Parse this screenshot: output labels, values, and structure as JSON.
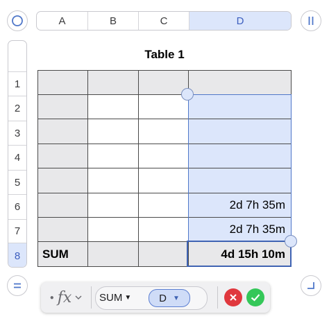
{
  "columns": [
    {
      "label": "A",
      "selected": false
    },
    {
      "label": "B",
      "selected": false
    },
    {
      "label": "C",
      "selected": false
    },
    {
      "label": "D",
      "selected": true
    }
  ],
  "rows": [
    {
      "label": "1",
      "selected": false
    },
    {
      "label": "2",
      "selected": false
    },
    {
      "label": "3",
      "selected": false
    },
    {
      "label": "4",
      "selected": false
    },
    {
      "label": "5",
      "selected": false
    },
    {
      "label": "6",
      "selected": false
    },
    {
      "label": "7",
      "selected": false
    },
    {
      "label": "8",
      "selected": true
    }
  ],
  "table": {
    "title": "Table 1",
    "cells": {
      "r6_d": "2d 7h 35m",
      "r7_d": "2d 7h 35m",
      "r8_a": "SUM",
      "r8_d": "4d 15h 10m"
    }
  },
  "formula": {
    "fx_label": "fx",
    "function_name": "SUM",
    "argument": "D"
  },
  "icons": {
    "select_all": "circle-icon",
    "freeze": "pause-bars-icon",
    "equals": "equals-icon",
    "resize": "corner-resize-icon",
    "cancel": "x-icon",
    "accept": "checkmark-icon"
  },
  "colors": {
    "selection_fill": "#dce6fb",
    "selection_border": "#3f63b3",
    "header_gray": "#e8e8ea",
    "cancel_red": "#e0383e",
    "accept_green": "#34c759"
  }
}
